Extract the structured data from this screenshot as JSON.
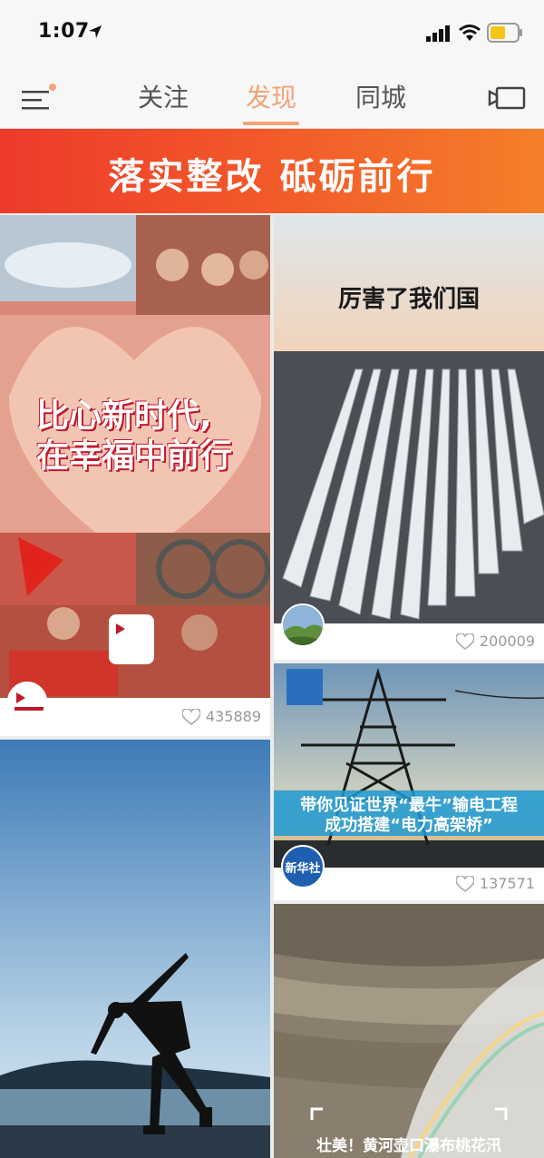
{
  "status": {
    "time": "1:07"
  },
  "nav": {
    "tabs": [
      {
        "label": "关注"
      },
      {
        "label": "发现"
      },
      {
        "label": "同城"
      }
    ]
  },
  "banner": {
    "text": "落实整改 砥砺前行"
  },
  "feed": [
    {
      "title_line1": "比心新时代,",
      "title_line2": "在幸福中前行",
      "badge": "央\n视频",
      "likes": "435889"
    },
    {
      "title": "厉害了我们国",
      "likes": "200009"
    },
    {
      "title_line1": "带你见证世界“最牛”输电工程",
      "title_line2": "成功搭建“电力高架桥”",
      "badge": "新华社",
      "likes": "137571"
    },
    {
      "title": "壮美！黄河壶口瀑布桃花汛"
    },
    {
      "title": ""
    }
  ]
}
